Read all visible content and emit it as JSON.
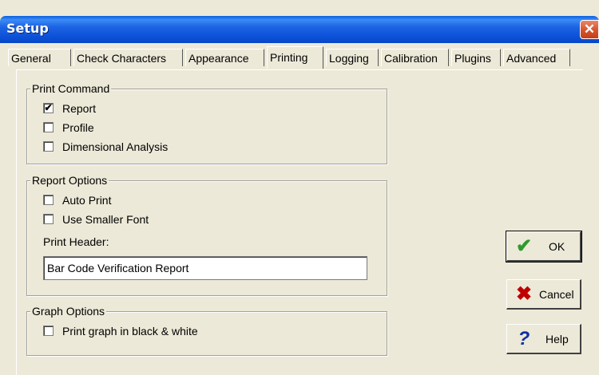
{
  "window": {
    "title": "Setup"
  },
  "close_label": "✕",
  "tabs": [
    {
      "label": "General"
    },
    {
      "label": "Check Characters"
    },
    {
      "label": "Appearance"
    },
    {
      "label": "Printing"
    },
    {
      "label": "Logging"
    },
    {
      "label": "Calibration"
    },
    {
      "label": "Plugins"
    },
    {
      "label": "Advanced"
    }
  ],
  "print_command": {
    "legend": "Print Command",
    "items": [
      {
        "label": "Report",
        "checked": true
      },
      {
        "label": "Profile",
        "checked": false
      },
      {
        "label": "Dimensional Analysis",
        "checked": false
      }
    ]
  },
  "report_options": {
    "legend": "Report Options",
    "items": [
      {
        "label": "Auto Print",
        "checked": false
      },
      {
        "label": "Use Smaller Font",
        "checked": false
      }
    ],
    "header_label": "Print Header:",
    "header_value": "Bar Code Verification Report"
  },
  "graph_options": {
    "legend": "Graph Options",
    "items": [
      {
        "label": "Print graph in black & white",
        "checked": false
      }
    ]
  },
  "buttons": {
    "ok": {
      "label": "OK",
      "icon": "checkmark-icon",
      "icon_color": "#2e9a2e"
    },
    "cancel": {
      "label": "Cancel",
      "icon": "x-icon",
      "icon_color": "#c00000"
    },
    "help": {
      "label": "Help",
      "icon": "question-icon",
      "icon_color": "#1030a0"
    }
  },
  "colors": {
    "titlebar": "#0a4fd6",
    "face": "#ece9d8",
    "close": "#d5532c"
  }
}
